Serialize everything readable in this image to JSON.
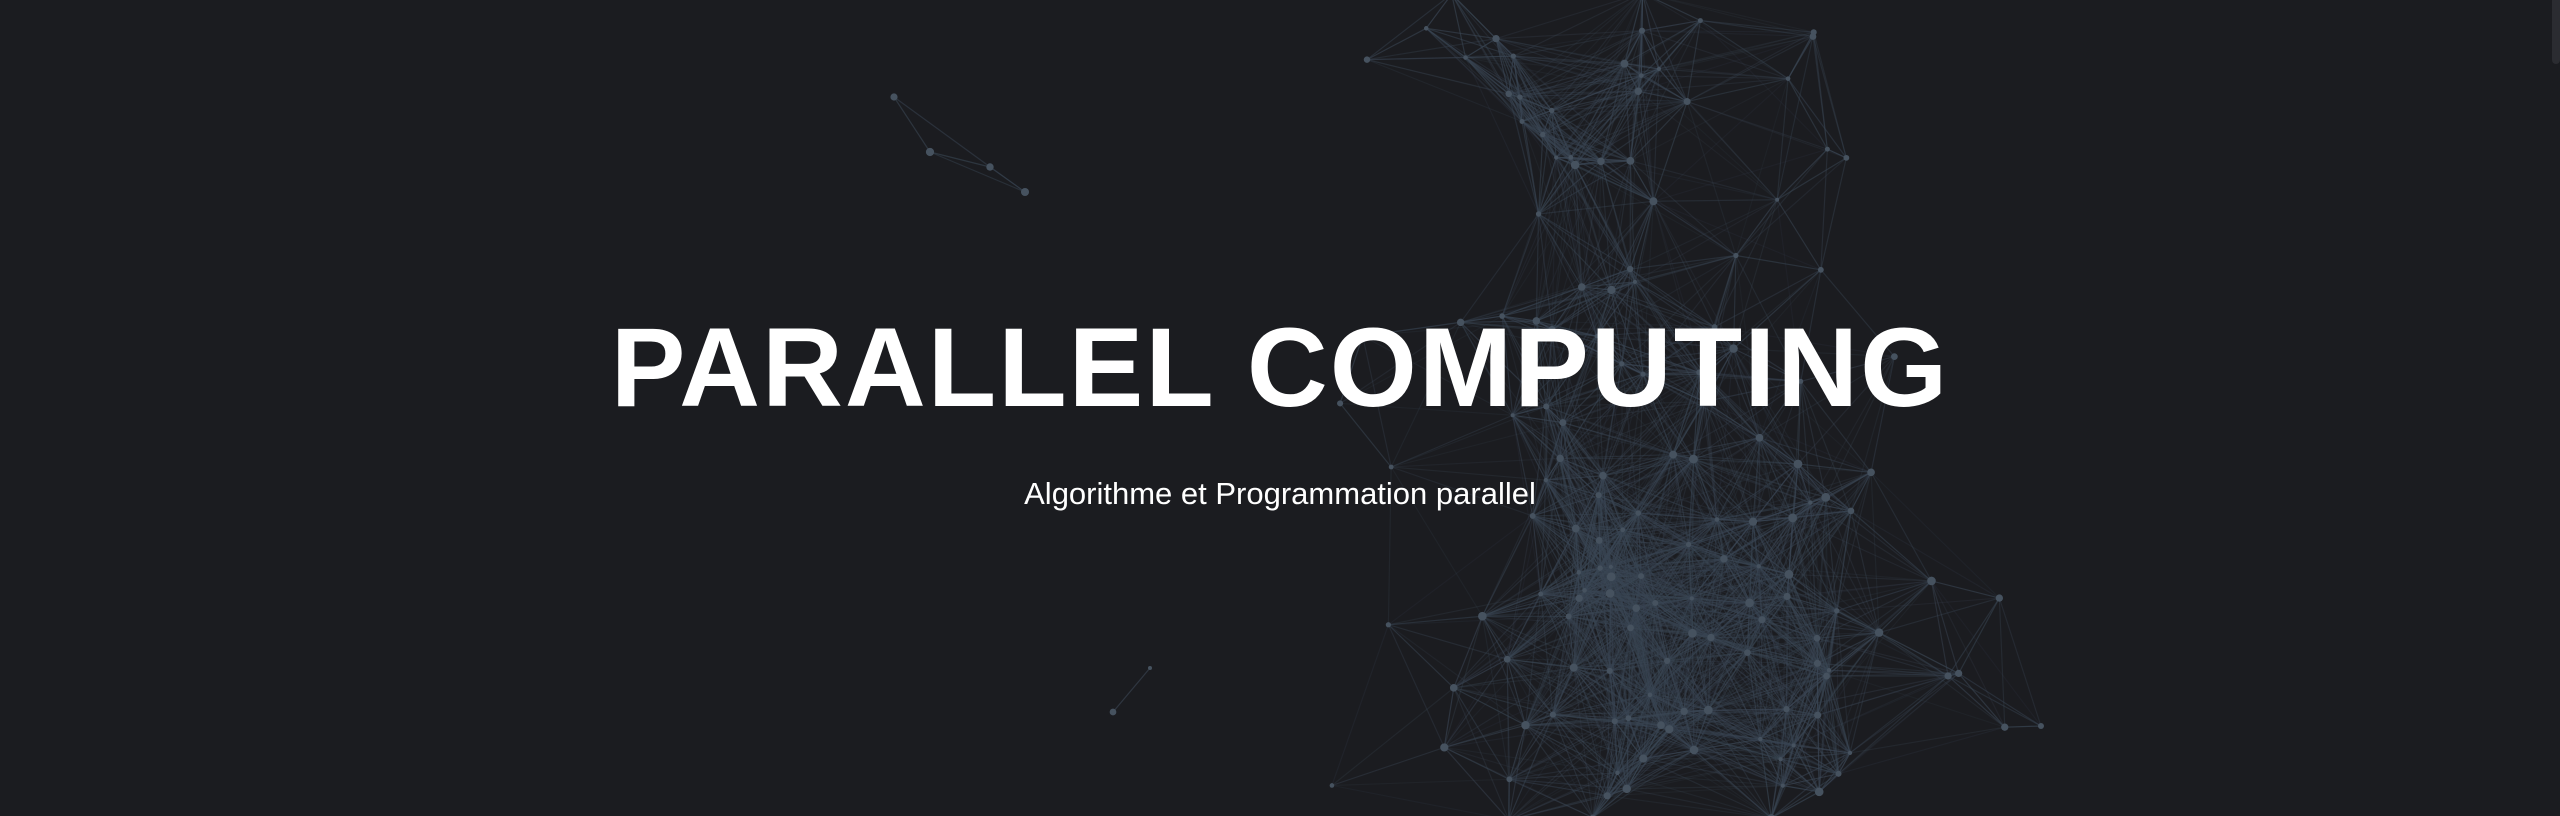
{
  "hero": {
    "title": "PARALLEL COMPUTING",
    "subtitle": "Algorithme et Programmation parallel"
  },
  "background": {
    "graphic": "particle-network",
    "colors": {
      "page": "#1b1c20",
      "line": "#3a4654",
      "node": "#46525f",
      "triangle": "#3b4958"
    }
  }
}
